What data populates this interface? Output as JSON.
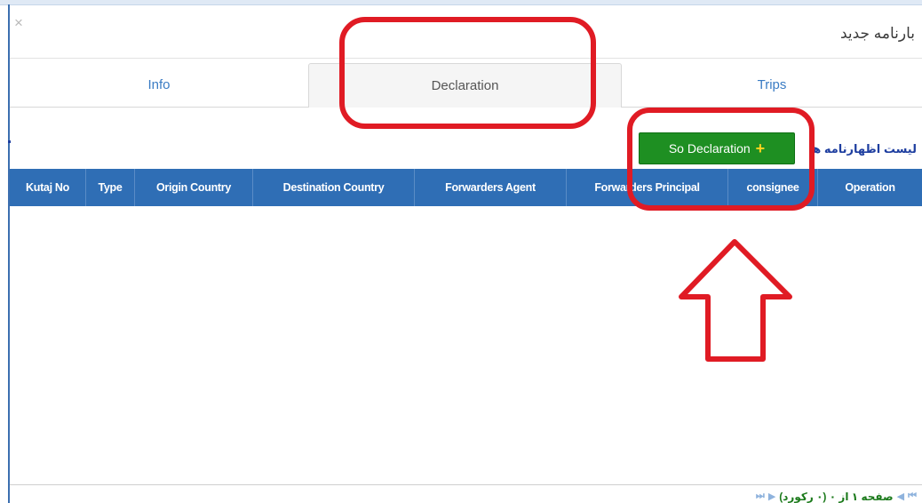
{
  "dialog": {
    "title": "بارنامه جدید",
    "close_glyph": "×"
  },
  "tabs": [
    {
      "label": "Info",
      "active": false
    },
    {
      "label": "Declaration",
      "active": true
    },
    {
      "label": "Trips",
      "active": false
    }
  ],
  "toolbar": {
    "list_label": "لیست اظهارنامه ها",
    "add_button_label": "So Declaration",
    "add_icon": "+"
  },
  "grid": {
    "columns": [
      "Kutaj No",
      "Type",
      "Origin Country",
      "Destination Country",
      "Forwarders Agent",
      "Forwarders Principal",
      "consignee",
      "Operation"
    ],
    "rows": []
  },
  "pager": {
    "text": "صفحه ۱ از ۰ (۰ رکورد)"
  },
  "colors": {
    "header_blue": "#2f6eb5",
    "button_green": "#1e8f22",
    "annotation_red": "#e01b24"
  },
  "icons": [
    "close-icon",
    "plus-icon",
    "first-page-icon",
    "prev-page-icon",
    "next-page-icon",
    "last-page-icon"
  ]
}
